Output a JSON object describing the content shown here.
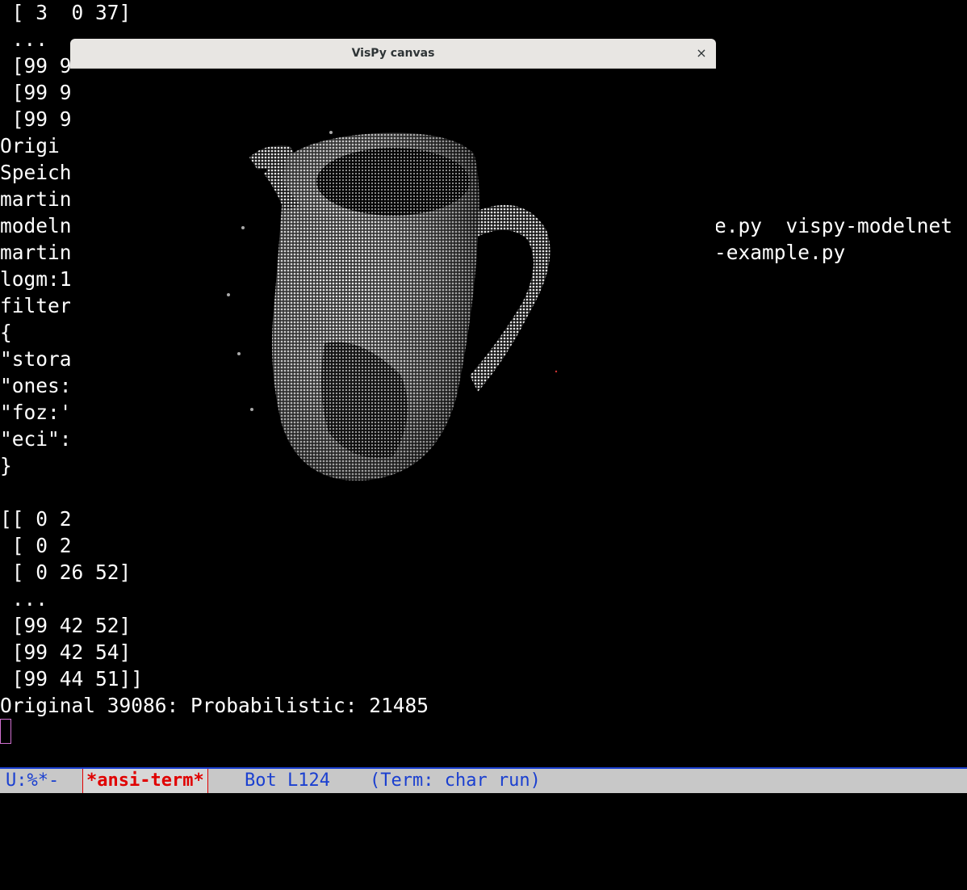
{
  "terminal": {
    "lines": [
      " [ 3  0 37]",
      " ...",
      " [99 9",
      " [99 9",
      " [99 9",
      "Origi",
      "Speich",
      "martin",
      "modeln",
      "martin",
      "logm:1",
      "filter",
      "{",
      "\"stora",
      "\"ones:",
      "\"foz:'",
      "\"eci\":",
      "}",
      "",
      "[[ 0 2",
      " [ 0 2",
      " [ 0 26 52]",
      " ...",
      " [99 42 52]",
      " [99 42 54]",
      " [99 44 51]]",
      "Original 39086: Probabilistic: 21485"
    ],
    "right_fragments": [
      "e.py  vispy-modelnet",
      "-example.py"
    ]
  },
  "vispy_window": {
    "title": "VisPy canvas",
    "close_glyph": "×"
  },
  "modeline": {
    "status": "U:%*-",
    "buffer": "*ansi-term*",
    "position": "Bot L124",
    "mode": "(Term: char run)"
  },
  "colors": {
    "modeline_fg": "#1a3fd0",
    "buffer_name": "#e00000",
    "cursor": "#d070d0"
  }
}
